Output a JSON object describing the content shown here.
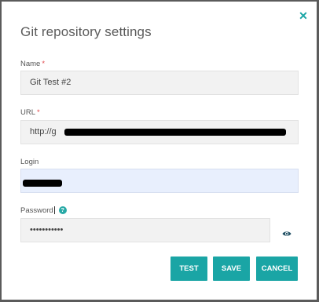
{
  "dialog": {
    "title": "Git repository settings",
    "close_icon": "close-icon"
  },
  "fields": {
    "name": {
      "label": "Name",
      "required_mark": "*",
      "value": "Git Test #2"
    },
    "url": {
      "label": "URL",
      "required_mark": "*",
      "value": "http://g"
    },
    "login": {
      "label": "Login",
      "value": ""
    },
    "password": {
      "label": "Password",
      "help": "?",
      "value": "•••••••••••"
    }
  },
  "buttons": {
    "test": "TEST",
    "save": "SAVE",
    "cancel": "CANCEL"
  },
  "colors": {
    "accent": "#1aa5a5",
    "required": "#e0484b",
    "input_bg": "#f2f2f2",
    "focused_input_bg": "#e8effd"
  },
  "icons": {
    "close": "close-icon",
    "help": "help-icon",
    "show_password": "eye-icon"
  }
}
